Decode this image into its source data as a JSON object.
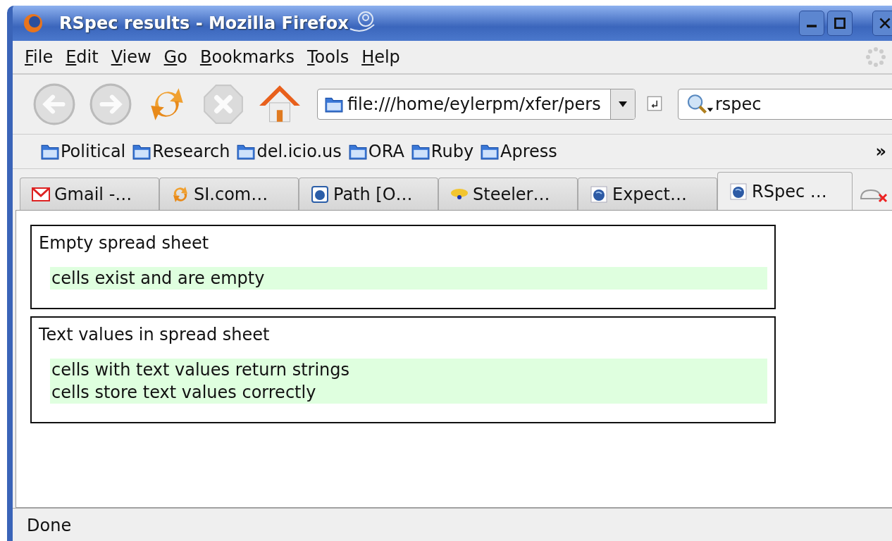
{
  "window": {
    "title": "RSpec results - Mozilla Firefox"
  },
  "menu": [
    "File",
    "Edit",
    "View",
    "Go",
    "Bookmarks",
    "Tools",
    "Help"
  ],
  "toolbar": {
    "back_disabled": true,
    "forward_disabled": true,
    "stop_disabled": true,
    "address": "file:///home/eylerpm/xfer/pers",
    "search": "rspec"
  },
  "bookmarks": [
    "Political",
    "Research",
    "del.icio.us",
    "ORA",
    "Ruby",
    "Apress"
  ],
  "bookmarks_overflow": "»",
  "tabs": [
    {
      "label": "Gmail -…",
      "selected": false
    },
    {
      "label": "SI.com…",
      "selected": false
    },
    {
      "label": "Path [O…",
      "selected": false
    },
    {
      "label": "Steeler…",
      "selected": false
    },
    {
      "label": "Expect…",
      "selected": false
    },
    {
      "label": "RSpec …",
      "selected": true
    }
  ],
  "specs": [
    {
      "title": "Empty spread sheet",
      "examples": [
        "cells exist and are empty"
      ]
    },
    {
      "title": "Text values in spread sheet",
      "examples": [
        "cells with text values return strings",
        "cells store text values correctly"
      ]
    }
  ],
  "status_bar": "Done"
}
